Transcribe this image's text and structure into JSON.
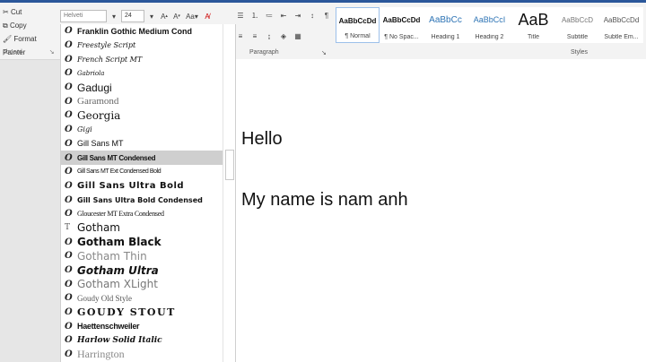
{
  "clipboard": {
    "cut": "Cut",
    "copy": "Copy",
    "format_painter": "Format Painter",
    "section": "pboard"
  },
  "font": {
    "name_value": "Helveti",
    "size_value": "24"
  },
  "paragraph": {
    "label": "Paragraph"
  },
  "styles": {
    "label": "Styles",
    "items": [
      {
        "preview": "AaBbCcDd",
        "name": "¶ Normal",
        "color": "#111111"
      },
      {
        "preview": "AaBbCcDd",
        "name": "¶ No Spac...",
        "color": "#111111"
      },
      {
        "preview": "AaBbCc",
        "name": "Heading 1",
        "color": "#2e74b5"
      },
      {
        "preview": "AaBbCcI",
        "name": "Heading 2",
        "color": "#2e74b5"
      },
      {
        "preview": "AaB",
        "name": "Title",
        "color": "#111111"
      },
      {
        "preview": "AaBbCcD",
        "name": "Subtitle",
        "color": "#777777"
      },
      {
        "preview": "AaBbCcDd",
        "name": "Subtle Em...",
        "color": "#555555"
      }
    ]
  },
  "font_list": [
    {
      "name": "Franklin Gothic Medium Cond",
      "icon": "O"
    },
    {
      "name": "Freestyle Script",
      "icon": "O"
    },
    {
      "name": "French Script MT",
      "icon": "O"
    },
    {
      "name": "Gabriola",
      "icon": "O"
    },
    {
      "name": "Gadugi",
      "icon": "O"
    },
    {
      "name": "Garamond",
      "icon": "O"
    },
    {
      "name": "Georgia",
      "icon": "O"
    },
    {
      "name": "Gigi",
      "icon": "O"
    },
    {
      "name": "Gill Sans MT",
      "icon": "O"
    },
    {
      "name": "Gill Sans MT Condensed",
      "icon": "O"
    },
    {
      "name": "Gill Sans MT Ext Condensed Bold",
      "icon": "O"
    },
    {
      "name": "Gill Sans Ultra Bold",
      "icon": "O"
    },
    {
      "name": "Gill Sans Ultra Bold Condensed",
      "icon": "O"
    },
    {
      "name": "Gloucester MT Extra Condensed",
      "icon": "O"
    },
    {
      "name": "Gotham",
      "icon": "T"
    },
    {
      "name": "Gotham Black",
      "icon": "O"
    },
    {
      "name": "Gotham Thin",
      "icon": "O"
    },
    {
      "name": "Gotham Ultra",
      "icon": "O"
    },
    {
      "name": "Gotham XLight",
      "icon": "O"
    },
    {
      "name": "Goudy Old Style",
      "icon": "O"
    },
    {
      "name": "GOUDY STOUT",
      "icon": "O"
    },
    {
      "name": "Haettenschweiler",
      "icon": "O"
    },
    {
      "name": "Harlow Solid Italic",
      "icon": "O"
    },
    {
      "name": "Harrington",
      "icon": "O"
    }
  ],
  "document": {
    "line1": "Hello",
    "line2": "My name is nam anh"
  }
}
